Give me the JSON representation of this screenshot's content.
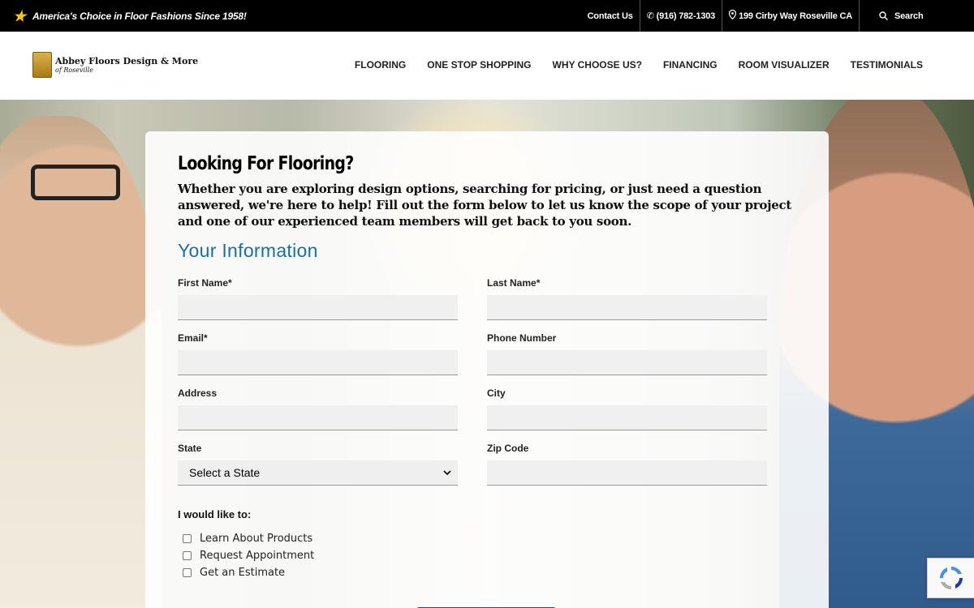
{
  "topbar": {
    "tagline": "America's Choice in Floor Fashions Since 1958!",
    "contact": "Contact Us",
    "phone": "(916) 782-1303",
    "address": "199 Cirby Way Roseville CA",
    "search": "Search"
  },
  "header": {
    "logo_title": "Abbey Floors Design & More",
    "logo_sub": "of Roseville",
    "nav": [
      "FLOORING",
      "ONE STOP SHOPPING",
      "WHY CHOOSE US?",
      "FINANCING",
      "ROOM VISUALIZER",
      "TESTIMONIALS"
    ]
  },
  "form": {
    "heading": "Looking For Flooring?",
    "intro": "Whether you are exploring design options, searching for pricing, or just need a question answered, we're here to help! Fill out the form below to let us know the scope of your project and one of our experienced team members will get back to you soon.",
    "section": "Your Information",
    "first_name": "First Name*",
    "last_name": "Last Name*",
    "email": "Email*",
    "phone": "Phone Number",
    "address": "Address",
    "city": "City",
    "state": "State",
    "state_value": "Select a State",
    "zip": "Zip Code",
    "like_label": "I would like to:",
    "options": [
      "Learn About Products",
      "Request Appointment",
      "Get an Estimate"
    ]
  },
  "colors": {
    "accent": "#1d6fa3",
    "topbar": "#000000",
    "star": "#f5c518"
  }
}
